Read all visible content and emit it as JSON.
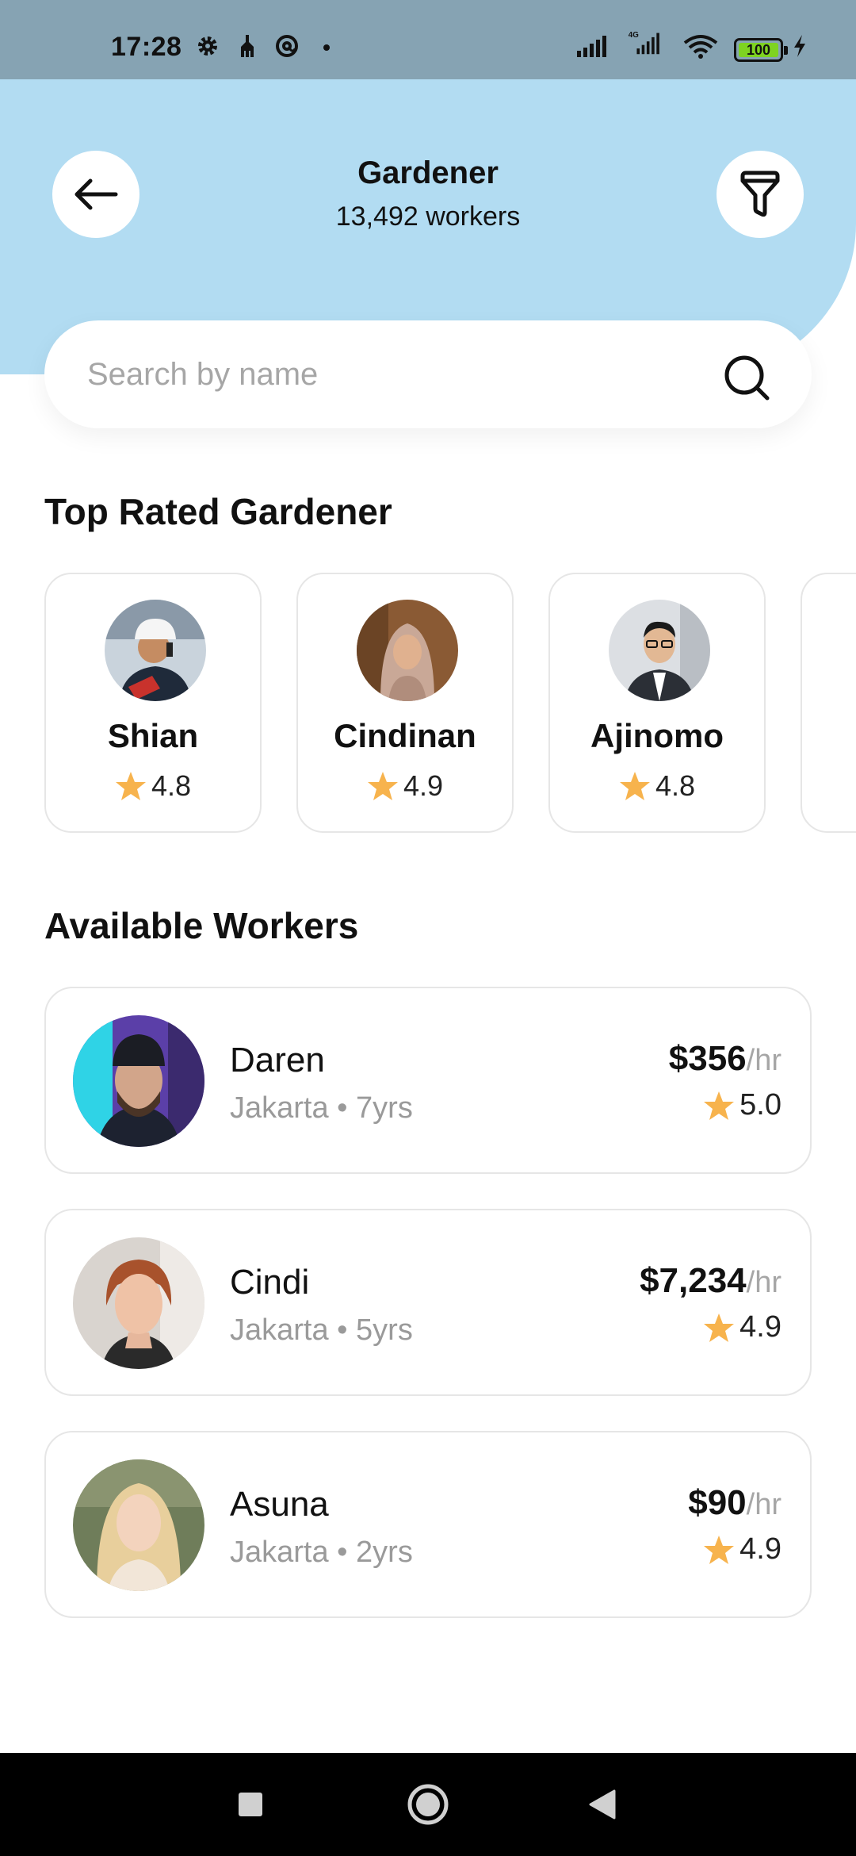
{
  "status_bar": {
    "time": "17:28",
    "battery": "100",
    "icons": [
      "gear-icon",
      "cleaning-icon",
      "at-icon",
      "signal-icon",
      "signal-4g-icon",
      "wifi-icon",
      "battery-icon",
      "charging-icon"
    ]
  },
  "header": {
    "title": "Gardener",
    "subtitle": "13,492 workers",
    "background_color": "#b2dcf2"
  },
  "search": {
    "placeholder": "Search by name",
    "value": ""
  },
  "top_rated": {
    "heading": "Top Rated Gardener",
    "items": [
      {
        "name": "Shian",
        "rating": "4.8"
      },
      {
        "name": "Cindinan",
        "rating": "4.9"
      },
      {
        "name": "Ajinomo",
        "rating": "4.8"
      },
      {
        "name": "",
        "rating": ""
      }
    ]
  },
  "available": {
    "heading": "Available Workers",
    "items": [
      {
        "name": "Daren",
        "meta": "Jakarta • 7yrs",
        "price": "$356",
        "per": "/hr",
        "rating": "5.0"
      },
      {
        "name": "Cindi",
        "meta": "Jakarta • 5yrs",
        "price": "$7,234",
        "per": "/hr",
        "rating": "4.9"
      },
      {
        "name": "Asuna",
        "meta": "Jakarta • 2yrs",
        "price": "$90",
        "per": "/hr",
        "rating": "4.9"
      }
    ]
  },
  "colors": {
    "status_bar": "#86a3b3",
    "star": "#f7b34d",
    "card_border": "#e6e6e6",
    "muted_text": "#9a9a9a"
  },
  "nav": {
    "icons": [
      "recents-square-icon",
      "home-circle-icon",
      "back-triangle-icon"
    ]
  }
}
